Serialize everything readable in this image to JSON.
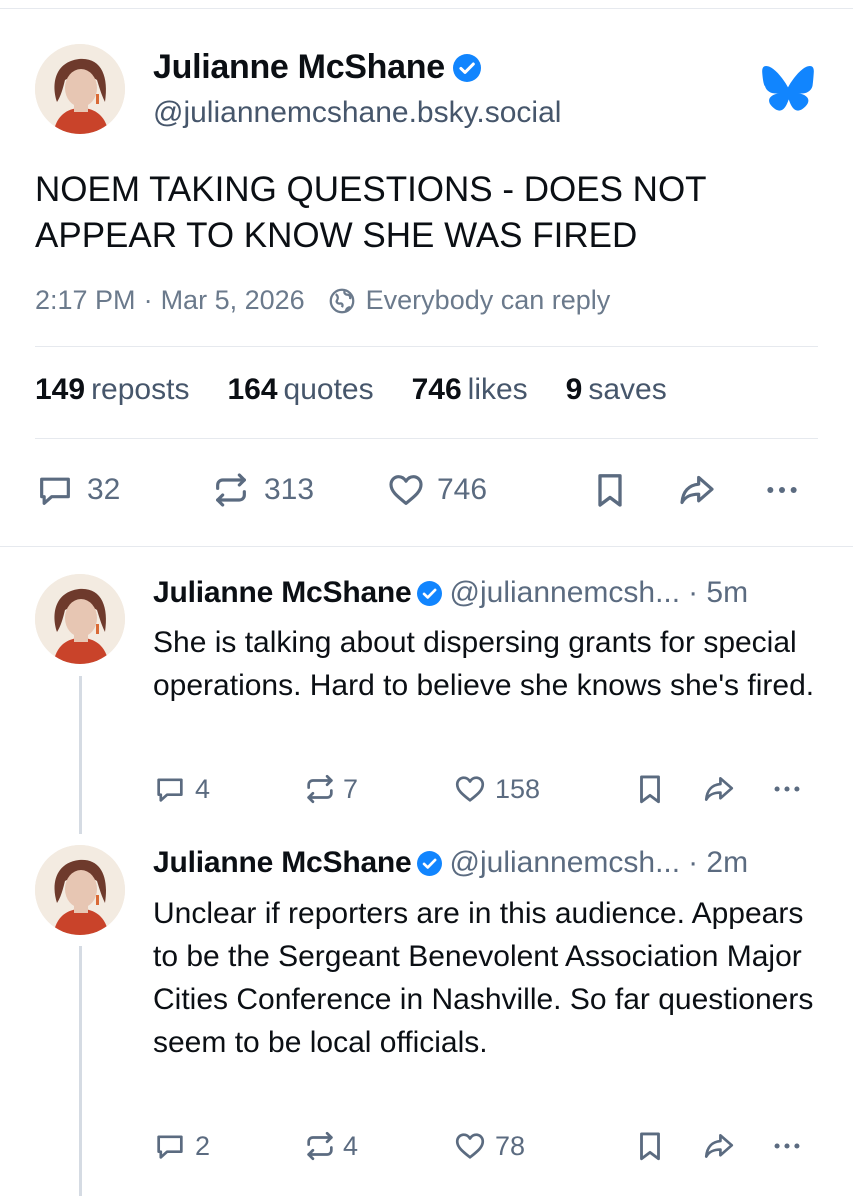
{
  "post": {
    "author_name": "Julianne McShane",
    "handle": "@juliannemcshane.bsky.social",
    "text": "NOEM TAKING QUESTIONS - DOES NOT APPEAR TO KNOW SHE WAS FIRED",
    "time": "2:17 PM",
    "separator": "·",
    "date": "Mar 5, 2026",
    "reply_setting": "Everybody can reply",
    "stats": {
      "reposts_count": "149",
      "reposts_label": "reposts",
      "quotes_count": "164",
      "quotes_label": "quotes",
      "likes_count": "746",
      "likes_label": "likes",
      "saves_count": "9",
      "saves_label": "saves"
    },
    "actions": {
      "replies": "32",
      "reposts": "313",
      "likes": "746"
    }
  },
  "replies": [
    {
      "author_name": "Julianne McShane",
      "handle": "@juliannemcsh...",
      "time": "· 5m",
      "text": "She is talking about dispersing grants for special operations. Hard to believe she knows she's fired.",
      "actions": {
        "replies": "4",
        "reposts": "7",
        "likes": "158"
      }
    },
    {
      "author_name": "Julianne McShane",
      "handle": "@juliannemcsh...",
      "time": "· 2m",
      "text": "Unclear if reporters are in this audience. Appears to be the Sergeant Benevolent Association Major Cities Conference in Nashville. So far questioners seem to be local officials.",
      "actions": {
        "replies": "2",
        "reposts": "4",
        "likes": "78"
      }
    }
  ],
  "icons": {
    "verified": "verified-badge-icon",
    "app_logo": "bluesky-butterfly-icon",
    "reply_setting": "globe-icon",
    "reply": "comment-bubble-icon",
    "repost": "repost-arrows-icon",
    "like": "heart-icon",
    "bookmark": "bookmark-icon",
    "share": "share-arrow-icon",
    "more": "more-dots-icon"
  },
  "colors": {
    "accent": "#1185fe",
    "text": "#0b0f14",
    "muted": "#5b6b80",
    "divider": "#e6e9ee"
  }
}
